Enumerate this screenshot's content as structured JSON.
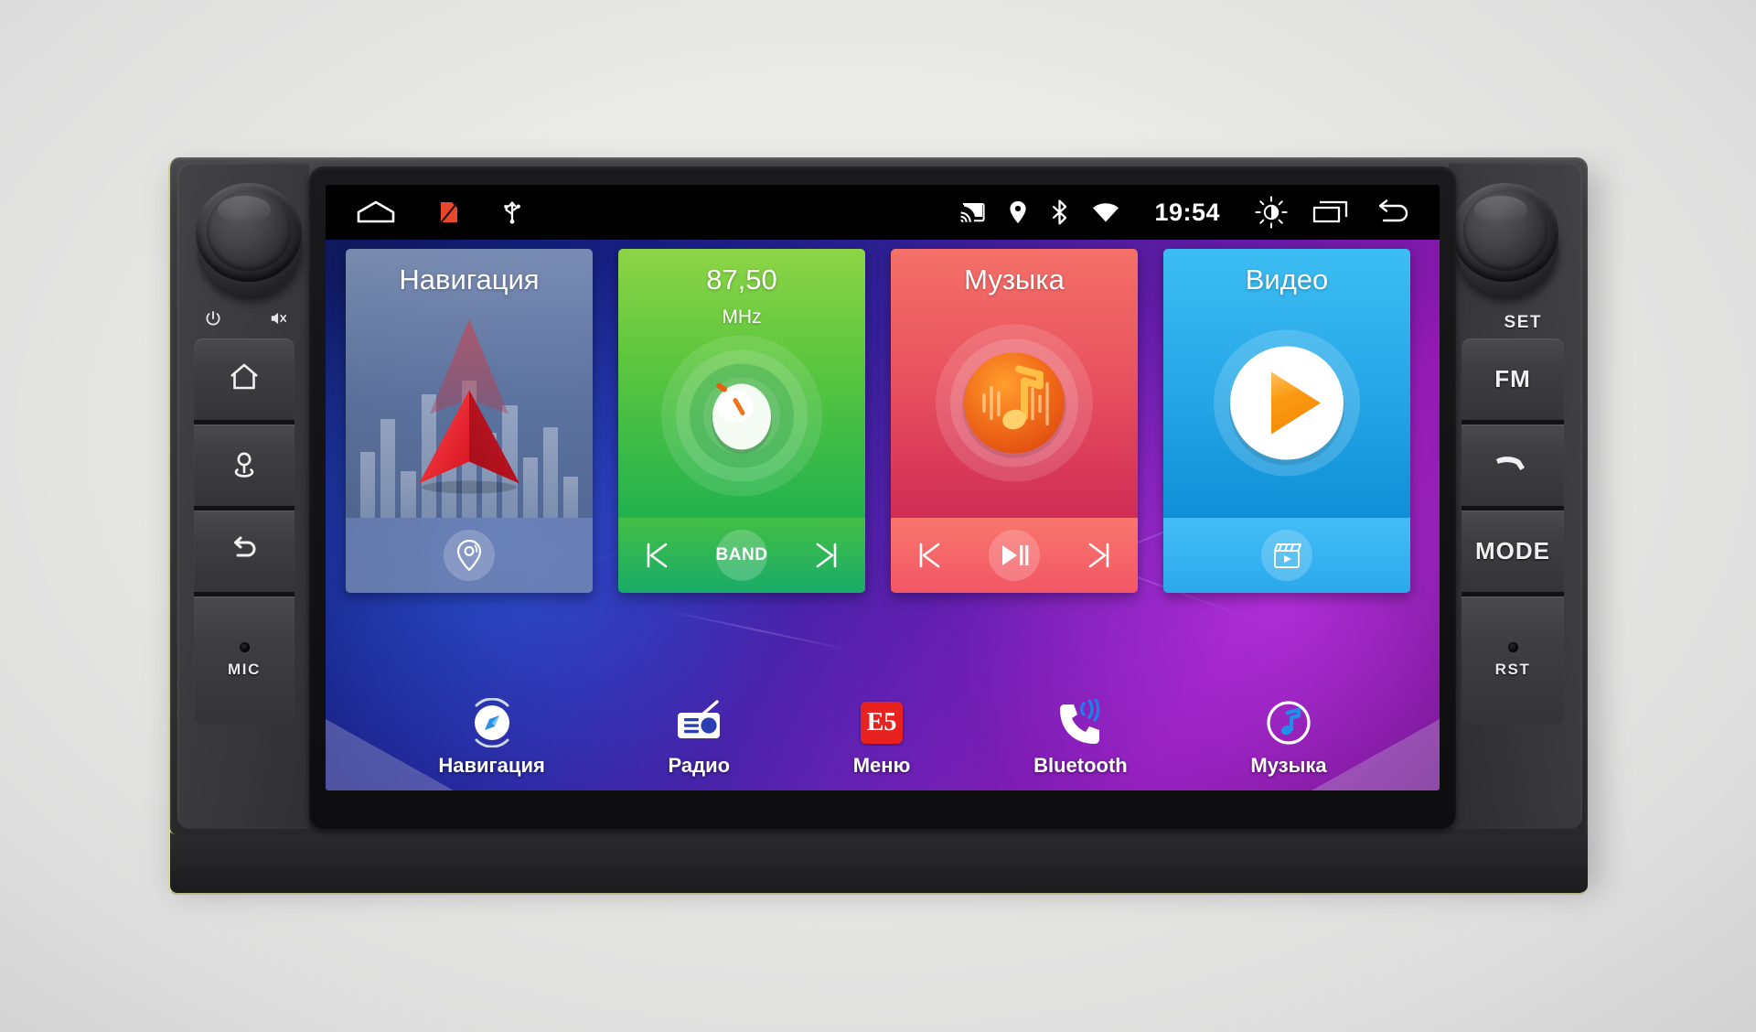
{
  "device": {
    "left_panel": {
      "power_symbol": "⏻",
      "mute_symbol": "mute-icon",
      "buttons": [
        {
          "name": "home",
          "icon": "home-icon",
          "label": ""
        },
        {
          "name": "navigation",
          "icon": "location-pin-icon",
          "label": ""
        },
        {
          "name": "back",
          "icon": "back-arrow-icon",
          "label": ""
        },
        {
          "name": "mic",
          "icon": "mic-pinhole-icon",
          "label": "MIC"
        }
      ]
    },
    "right_panel": {
      "knob_label": "SET",
      "buttons": [
        {
          "name": "fm",
          "icon": "",
          "label": "FM"
        },
        {
          "name": "phone",
          "icon": "phone-handset-icon",
          "label": ""
        },
        {
          "name": "mode",
          "icon": "",
          "label": "MODE"
        },
        {
          "name": "reset",
          "icon": "reset-pinhole-icon",
          "label": "RST"
        }
      ]
    }
  },
  "statusbar": {
    "left_icons": [
      "home-outline-icon",
      "sim-card-off-icon",
      "usb-icon"
    ],
    "right_icons": [
      "cast-icon",
      "location-pin-icon",
      "bluetooth-icon",
      "wifi-icon"
    ],
    "clock": "19:54",
    "trailing_icons": [
      "brightness-icon",
      "recents-icon",
      "back-arrow-icon"
    ]
  },
  "cards": [
    {
      "id": "navigation",
      "title": "Навигация",
      "subtitle": "",
      "accent": "#6c829e",
      "main_icon": "navigation-arrow-icon",
      "controls": [
        {
          "name": "nav-locate-button",
          "icon": "location-pin-icon",
          "label": ""
        }
      ]
    },
    {
      "id": "radio",
      "title": "87,50",
      "subtitle": "MHz",
      "accent": "#5cc63e",
      "main_icon": "tuner-knob-icon",
      "controls": [
        {
          "name": "radio-prev-button",
          "icon": "skip-previous-icon",
          "label": ""
        },
        {
          "name": "radio-band-button",
          "icon": "",
          "label": "BAND"
        },
        {
          "name": "radio-next-button",
          "icon": "skip-next-icon",
          "label": ""
        }
      ]
    },
    {
      "id": "music",
      "title": "Музыка",
      "subtitle": "",
      "accent": "#e8515f",
      "main_icon": "music-note-icon",
      "controls": [
        {
          "name": "music-prev-button",
          "icon": "skip-previous-icon",
          "label": ""
        },
        {
          "name": "music-playpause-button",
          "icon": "play-pause-icon",
          "label": ""
        },
        {
          "name": "music-next-button",
          "icon": "skip-next-icon",
          "label": ""
        }
      ]
    },
    {
      "id": "video",
      "title": "Видео",
      "subtitle": "",
      "accent": "#27a8e8",
      "main_icon": "play-circle-icon",
      "controls": [
        {
          "name": "video-library-button",
          "icon": "clapperboard-icon",
          "label": ""
        }
      ]
    }
  ],
  "dock": [
    {
      "name": "navigation",
      "label": "Навигация",
      "icon": "compass-icon"
    },
    {
      "name": "radio",
      "label": "Радио",
      "icon": "radio-icon"
    },
    {
      "name": "menu",
      "label": "Меню",
      "icon": "e5-app-icon",
      "badge": "E5"
    },
    {
      "name": "bluetooth",
      "label": "Bluetooth",
      "icon": "phone-call-icon"
    },
    {
      "name": "music",
      "label": "Музыка",
      "icon": "music-note-circle-icon"
    }
  ],
  "colors": {
    "nav_card": "#6c829e",
    "radio_card": "#5cc63e",
    "music_card": "#e8515f",
    "video_card": "#27a8e8",
    "menu_badge": "#e8231f",
    "play_orange": "#f79a12",
    "status_bar": "#000000"
  }
}
